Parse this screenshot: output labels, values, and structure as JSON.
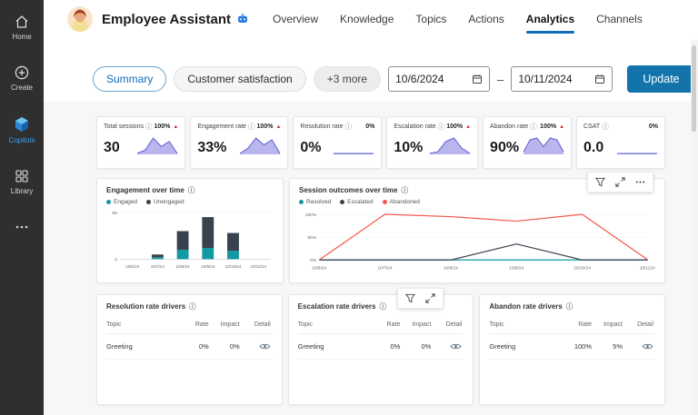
{
  "sidebar": {
    "items": [
      {
        "id": "home",
        "label": "Home"
      },
      {
        "id": "create",
        "label": "Create"
      },
      {
        "id": "copilots",
        "label": "Copilots",
        "active": true
      },
      {
        "id": "library",
        "label": "Library"
      },
      {
        "id": "more",
        "label": ""
      }
    ]
  },
  "header": {
    "title": "Employee Assistant",
    "tabs": [
      {
        "label": "Overview"
      },
      {
        "label": "Knowledge"
      },
      {
        "label": "Topics"
      },
      {
        "label": "Actions"
      },
      {
        "label": "Analytics",
        "active": true
      },
      {
        "label": "Channels"
      }
    ]
  },
  "toolbar": {
    "filters": [
      {
        "label": "Summary",
        "selected": true
      },
      {
        "label": "Customer satisfaction",
        "selected": false
      },
      {
        "label": "+3 more",
        "selected": false
      }
    ],
    "date_start": "10/6/2024",
    "date_separator": "–",
    "date_end": "10/11/2024",
    "update_label": "Update"
  },
  "kpis": [
    {
      "label": "Total sessions",
      "change": "100%",
      "trend": "up",
      "value": "30",
      "spark": [
        0,
        2,
        9,
        4,
        7,
        0
      ]
    },
    {
      "label": "Engagement rate",
      "change": "100%",
      "trend": "up",
      "value": "33%",
      "spark": [
        0,
        3,
        9,
        5,
        8,
        0
      ]
    },
    {
      "label": "Resolution rate",
      "change": "0%",
      "trend": "flat",
      "value": "0%",
      "spark": [
        0,
        0,
        0,
        0,
        0,
        0
      ]
    },
    {
      "label": "Escalation rate",
      "change": "100%",
      "trend": "up",
      "value": "10%",
      "spark": [
        0,
        1,
        7,
        9,
        3,
        0
      ]
    },
    {
      "label": "Abandon rate",
      "change": "100%",
      "trend": "up",
      "value": "90%",
      "spark": [
        1,
        8,
        9,
        4,
        9,
        8,
        1
      ]
    },
    {
      "label": "CSAT",
      "change": "0%",
      "trend": "flat",
      "value": "0.0",
      "spark": [
        0,
        0,
        0,
        0,
        0,
        0
      ]
    }
  ],
  "chart_data": [
    {
      "type": "bar",
      "stacked": true,
      "title": "Engagement over time",
      "categories": [
        "10/6/24",
        "10/7/24",
        "10/8/24",
        "10/9/24",
        "10/10/24",
        "10/11/24"
      ],
      "series": [
        {
          "name": "Engaged",
          "color": "#129aa1",
          "values": [
            0,
            2,
            10,
            12,
            9,
            0
          ]
        },
        {
          "name": "Unengaged",
          "color": "#39414f",
          "values": [
            0,
            3,
            20,
            33,
            19,
            0
          ]
        }
      ],
      "ylim": [
        0,
        50
      ],
      "yticks": [
        {
          "v": 0,
          "label": "0"
        },
        {
          "v": 50,
          "label": "50"
        }
      ],
      "legend_position": "top-left",
      "grid": false
    },
    {
      "type": "line",
      "title": "Session outcomes over time",
      "categories": [
        "10/6/24",
        "10/7/24",
        "10/8/24",
        "10/9/24",
        "10/10/24",
        "10/11/24"
      ],
      "series": [
        {
          "name": "Resolved",
          "color": "#129aa1",
          "values": [
            0,
            0,
            0,
            0,
            0,
            0
          ]
        },
        {
          "name": "Escalated",
          "color": "#39414f",
          "values": [
            0,
            0,
            0,
            35,
            0,
            0
          ]
        },
        {
          "name": "Abandoned",
          "color": "#f4574c",
          "values": [
            0,
            100,
            95,
            85,
            100,
            0
          ]
        }
      ],
      "ylim": [
        0,
        100
      ],
      "yticks": [
        {
          "v": 0,
          "label": "0%"
        },
        {
          "v": 50,
          "label": "50%"
        },
        {
          "v": 100,
          "label": "100%"
        }
      ],
      "legend_position": "top-left",
      "grid": true
    }
  ],
  "drivers": [
    {
      "title": "Resolution rate drivers",
      "columns": [
        "Topic",
        "Rate",
        "Impact",
        "Detail"
      ],
      "rows": [
        {
          "topic": "Greeting",
          "rate": "0%",
          "impact": "0%"
        }
      ]
    },
    {
      "title": "Escalation rate drivers",
      "columns": [
        "Topic",
        "Rate",
        "Impact",
        "Detail"
      ],
      "rows": [
        {
          "topic": "Greeting",
          "rate": "0%",
          "impact": "0%"
        }
      ]
    },
    {
      "title": "Abandon rate drivers",
      "columns": [
        "Topic",
        "Rate",
        "Impact",
        "Detail"
      ],
      "rows": [
        {
          "topic": "Greeting",
          "rate": "100%",
          "impact": "5%"
        }
      ]
    }
  ],
  "colors": {
    "accent": "#0f6cbd",
    "update_button": "#1374ab",
    "spark_fill": "#b9b6ee",
    "spark_stroke": "#5f5bd7",
    "negative": "#d13438"
  }
}
